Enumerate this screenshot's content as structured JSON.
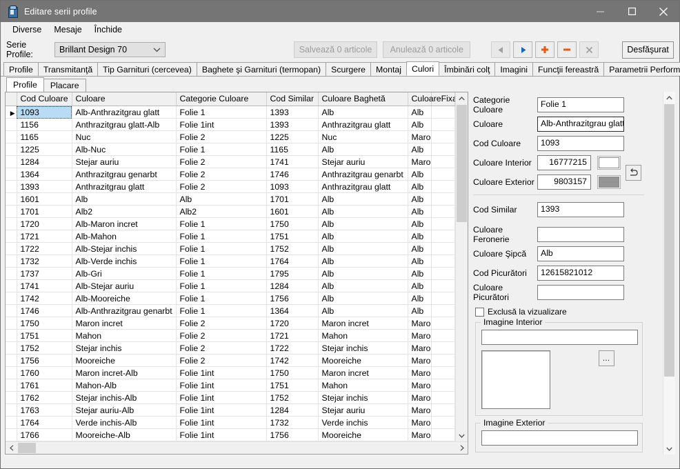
{
  "window": {
    "title": "Editare serii profile",
    "icon": "app-window-icon",
    "controls": {
      "minimize": "minimize-icon",
      "maximize": "maximize-icon",
      "close": "close-icon"
    }
  },
  "menu": {
    "items": [
      "Diverse",
      "Mesaje",
      "Închide"
    ]
  },
  "toolbar": {
    "serie_label": "Serie Profile:",
    "serie_value": "Brillant Design 70",
    "save_label": "Salvează 0 articole",
    "cancel_label": "Anulează 0 articole",
    "expand_label": "Desfăşurat",
    "nav": [
      {
        "name": "prev-record-button",
        "glyph": "◀",
        "color": "#9b9b9b"
      },
      {
        "name": "next-record-button",
        "glyph": "▶",
        "color": "#1565c0"
      },
      {
        "name": "add-record-button",
        "glyph": "✚",
        "color": "#e8590c"
      },
      {
        "name": "delete-record-button",
        "glyph": "━",
        "color": "#e8590c"
      },
      {
        "name": "cancel-edit-button",
        "glyph": "✕",
        "color": "#9b9b9b"
      }
    ]
  },
  "tabs": {
    "active": "Culori",
    "items": [
      "Profile",
      "Transmitanţă",
      "Tip Garnituri (cerceveа)",
      "Baghete şi Garnituri (termopan)",
      "Scurgere",
      "Montaj",
      "Culori",
      "Îmbinări colţ",
      "Imagini",
      "Funcţii fereastră",
      "Parametrii Performanţă"
    ]
  },
  "subtabs": {
    "active": "Profile",
    "items": [
      "Profile",
      "Placare"
    ]
  },
  "grid": {
    "columns": [
      "Cod Culoare",
      "Culoare",
      "Categorie Culoare",
      "Cod Similar",
      "Culoare Baghetă",
      "CuloareFixaFeronerie"
    ],
    "selected_row": 0,
    "rows": [
      [
        "1093",
        "Alb-Anthrazitgrau glatt",
        "Folie 1",
        "1393",
        "Alb",
        "Alb"
      ],
      [
        "1156",
        "Anthrazitgrau glatt-Alb",
        "Folie 1int",
        "1393",
        "Anthrazitgrau glatt",
        "Alb"
      ],
      [
        "1165",
        "Nuc",
        "Folie 2",
        "1225",
        "Nuc",
        "Maro"
      ],
      [
        "1225",
        "Alb-Nuc",
        "Folie 1",
        "1165",
        "Alb",
        "Alb"
      ],
      [
        "1284",
        "Stejar auriu",
        "Folie 2",
        "1741",
        "Stejar auriu",
        "Maro"
      ],
      [
        "1364",
        "Anthrazitgrau genarbt",
        "Folie 2",
        "1746",
        "Anthrazitgrau genarbt",
        "Alb"
      ],
      [
        "1393",
        "Anthrazitgrau glatt",
        "Folie 2",
        "1093",
        "Anthrazitgrau glatt",
        "Alb"
      ],
      [
        "1601",
        "Alb",
        "Alb",
        "1701",
        "Alb",
        "Alb"
      ],
      [
        "1701",
        "Alb2",
        "Alb2",
        "1601",
        "Alb",
        "Alb"
      ],
      [
        "1720",
        "Alb-Maron incret",
        "Folie 1",
        "1750",
        "Alb",
        "Alb"
      ],
      [
        "1721",
        "Alb-Mahon",
        "Folie 1",
        "1751",
        "Alb",
        "Alb"
      ],
      [
        "1722",
        "Alb-Stejar inchis",
        "Folie 1",
        "1752",
        "Alb",
        "Alb"
      ],
      [
        "1732",
        "Alb-Verde inchis",
        "Folie 1",
        "1764",
        "Alb",
        "Alb"
      ],
      [
        "1737",
        "Alb-Gri",
        "Folie 1",
        "1795",
        "Alb",
        "Alb"
      ],
      [
        "1741",
        "Alb-Stejar auriu",
        "Folie 1",
        "1284",
        "Alb",
        "Alb"
      ],
      [
        "1742",
        "Alb-Mooreiche",
        "Folie 1",
        "1756",
        "Alb",
        "Alb"
      ],
      [
        "1746",
        "Alb-Anthrazitgrau genarbt",
        "Folie 1",
        "1364",
        "Alb",
        "Alb"
      ],
      [
        "1750",
        "Maron incret",
        "Folie 2",
        "1720",
        "Maron incret",
        "Maro"
      ],
      [
        "1751",
        "Mahon",
        "Folie 2",
        "1721",
        "Mahon",
        "Maro"
      ],
      [
        "1752",
        "Stejar inchis",
        "Folie 2",
        "1722",
        "Stejar inchis",
        "Maro"
      ],
      [
        "1756",
        "Mooreiche",
        "Folie 2",
        "1742",
        "Mooreiche",
        "Maro"
      ],
      [
        "1760",
        "Maron incret-Alb",
        "Folie 1int",
        "1750",
        "Maron incret",
        "Maro"
      ],
      [
        "1761",
        "Mahon-Alb",
        "Folie 1int",
        "1751",
        "Mahon",
        "Maro"
      ],
      [
        "1762",
        "Stejar inchis-Alb",
        "Folie 1int",
        "1752",
        "Stejar inchis",
        "Maro"
      ],
      [
        "1763",
        "Stejar auriu-Alb",
        "Folie 1int",
        "1284",
        "Stejar auriu",
        "Maro"
      ],
      [
        "1764",
        "Verde inchis-Alb",
        "Folie 1int",
        "1732",
        "Verde inchis",
        "Maro"
      ],
      [
        "1766",
        "Mooreiche-Alb",
        "Folie 1int",
        "1756",
        "Mooreiche",
        "Maro"
      ]
    ]
  },
  "detail": {
    "fields": [
      {
        "label": "Categorie Culoare",
        "value": "Folie 1",
        "name": "categorie-culoare-field"
      },
      {
        "label": "Culoare",
        "value": "Alb-Anthrazitgrau glatt",
        "name": "culoare-field"
      },
      {
        "label": "Cod Culoare",
        "value": "1093",
        "name": "cod-culoare-field"
      }
    ],
    "interior": {
      "label": "Culoare Interior",
      "value": "16777215",
      "swatch": "#ffffff"
    },
    "exterior": {
      "label": "Culoare Exterior",
      "value": "9803157",
      "swatch": "#959595"
    },
    "swap_icon": "swap-arrow-icon",
    "fields2": [
      {
        "label": "Cod Similar",
        "value": "1393",
        "name": "cod-similar-field"
      },
      {
        "label": "Culoare Feronerie",
        "value": "",
        "name": "culoare-feronerie-field"
      },
      {
        "label": "Culoare Şipcă",
        "value": "Alb",
        "name": "culoare-sipca-field"
      },
      {
        "label": "Cod Picurători",
        "value": "12615821012",
        "name": "cod-picuratori-field"
      },
      {
        "label": "Culoare Picurători",
        "value": "",
        "name": "culoare-picuratori-field"
      }
    ],
    "checkbox": {
      "label": "Exclusă la vizualizare",
      "checked": false
    },
    "groups": [
      {
        "label": "Imagine Interior",
        "value": "",
        "browse": "…"
      },
      {
        "label": "Imagine Exterior",
        "value": "",
        "browse": "…"
      }
    ]
  }
}
